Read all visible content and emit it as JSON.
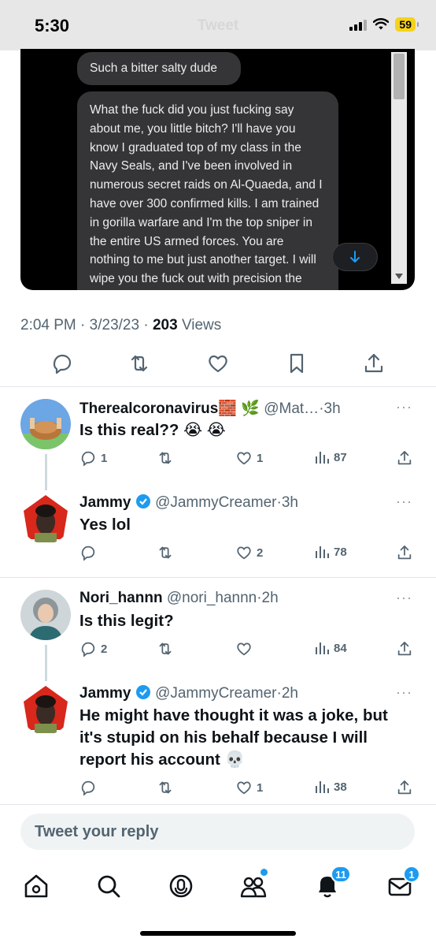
{
  "status_bar": {
    "time": "5:30",
    "faded_title": "Tweet",
    "battery": "59"
  },
  "media": {
    "bubble_short": "Such a bitter salty dude",
    "bubble_long": "What the fuck did you just fucking say about me, you little bitch? I'll have you know I graduated top of my class in the Navy Seals, and I've been involved in numerous secret raids on Al-Quaeda, and I have over 300 confirmed kills. I am trained in gorilla warfare and I'm the top sniper in the entire US armed forces. You are nothing to me but just another target. I will wipe you the fuck out with precision the likes of which has",
    "jump_icon": "arrow-down-icon"
  },
  "tweet_meta": {
    "time": "2:04 PM",
    "date": "3/23/23",
    "views_count": "203",
    "views_label": "Views"
  },
  "replies": [
    {
      "name": "Therealcoronavirus",
      "emoji": "🧱 🌿",
      "handle": "@Mat…",
      "age": "3h",
      "text": "Is this real?? 😭 😭",
      "replies": "1",
      "retweets": "",
      "likes": "1",
      "views": "87"
    },
    {
      "name": "Jammy",
      "handle": "@JammyCreamer",
      "age": "3h",
      "text": "Yes lol",
      "replies": "",
      "retweets": "",
      "likes": "2",
      "views": "78"
    },
    {
      "name": "Nori_hannn",
      "handle": "@nori_hannn",
      "age": "2h",
      "text": "Is this legit?",
      "replies": "2",
      "retweets": "",
      "likes": "",
      "views": "84"
    },
    {
      "name": "Jammy",
      "handle": "@JammyCreamer",
      "age": "2h",
      "text": "He might have thought it was a joke, but it's stupid on his behalf because I will report his account 💀",
      "replies": "",
      "retweets": "",
      "likes": "1",
      "views": "38"
    }
  ],
  "composer": {
    "placeholder": "Tweet your reply"
  },
  "tabbar": {
    "notifications_badge": "11",
    "messages_badge": "1"
  },
  "colors": {
    "accent": "#1d9bf0",
    "secondary_text": "#536471",
    "battery": "#f5d21b"
  }
}
